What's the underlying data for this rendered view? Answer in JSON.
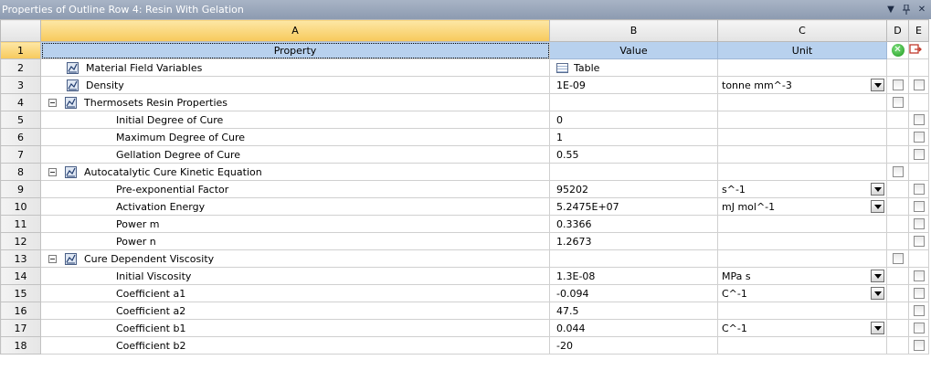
{
  "window": {
    "title": "Properties of Outline Row 4: Resin With Gelation"
  },
  "columns": {
    "a": "A",
    "b": "B",
    "c": "C",
    "d": "D",
    "e": "E"
  },
  "header_row": {
    "num": "1",
    "property": "Property",
    "value": "Value",
    "unit": "Unit"
  },
  "rows": [
    {
      "num": "2",
      "property": "Material Field Variables",
      "value": "Table",
      "unit": ""
    },
    {
      "num": "3",
      "property": "Density",
      "value": "1E-09",
      "unit": "tonne mm^-3"
    },
    {
      "num": "4",
      "property": "Thermosets Resin Properties",
      "value": "",
      "unit": ""
    },
    {
      "num": "5",
      "property": "Initial Degree of Cure",
      "value": "0",
      "unit": ""
    },
    {
      "num": "6",
      "property": "Maximum Degree of Cure",
      "value": "1",
      "unit": ""
    },
    {
      "num": "7",
      "property": "Gellation Degree of Cure",
      "value": "0.55",
      "unit": ""
    },
    {
      "num": "8",
      "property": "Autocatalytic Cure Kinetic Equation",
      "value": "",
      "unit": ""
    },
    {
      "num": "9",
      "property": "Pre-exponential Factor",
      "value": "95202",
      "unit": "s^-1"
    },
    {
      "num": "10",
      "property": "Activation Energy",
      "value": "5.2475E+07",
      "unit": "mJ mol^-1"
    },
    {
      "num": "11",
      "property": "Power m",
      "value": "0.3366",
      "unit": ""
    },
    {
      "num": "12",
      "property": "Power n",
      "value": "1.2673",
      "unit": ""
    },
    {
      "num": "13",
      "property": "Cure Dependent Viscosity",
      "value": "",
      "unit": ""
    },
    {
      "num": "14",
      "property": "Initial Viscosity",
      "value": "1.3E-08",
      "unit": "MPa s"
    },
    {
      "num": "15",
      "property": "Coefficient a1",
      "value": "-0.094",
      "unit": "C^-1"
    },
    {
      "num": "16",
      "property": "Coefficient a2",
      "value": "47.5",
      "unit": ""
    },
    {
      "num": "17",
      "property": "Coefficient b1",
      "value": "0.044",
      "unit": "C^-1"
    },
    {
      "num": "18",
      "property": "Coefficient b2",
      "value": "-20",
      "unit": ""
    }
  ]
}
